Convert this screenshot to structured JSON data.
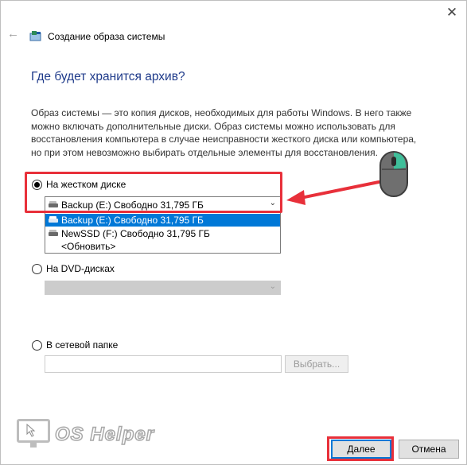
{
  "window": {
    "title": "Создание образа системы",
    "close_glyph": "✕",
    "back_glyph": "←"
  },
  "heading": "Где будет хранится архив?",
  "description": "Образ системы — это копия дисков, необходимых для работы Windows. В него также можно включать дополнительные диски. Образ системы можно использовать для восстановления компьютера в случае неисправности жесткого диска или компьютера, но при этом невозможно выбирать отдельные элементы для восстановления.",
  "options": {
    "hard_disk": {
      "label": "На жестком диске",
      "selected": true
    },
    "dvd": {
      "label": "На DVD-дисках",
      "selected": false
    },
    "network": {
      "label": "В сетевой папке",
      "selected": false
    }
  },
  "hard_disk_combo": {
    "value": "Backup (E:)  Свободно 31,795 ГБ",
    "items": [
      {
        "label": "Backup (E:)  Свободно 31,795 ГБ",
        "selected": true,
        "icon": "drive-icon"
      },
      {
        "label": "NewSSD (F:)  Свободно 31,795 ГБ",
        "selected": false,
        "icon": "drive-icon"
      },
      {
        "label": "<Обновить>",
        "selected": false
      }
    ]
  },
  "network": {
    "browse_label": "Выбрать..."
  },
  "buttons": {
    "next": "Далее",
    "cancel": "Отмена"
  },
  "watermark": {
    "text": "OS Helper"
  },
  "colors": {
    "accent": "#0078d7",
    "heading": "#1e3a8a",
    "annotation": "#e8303a",
    "mouse_highlight": "#3fbf9a"
  }
}
